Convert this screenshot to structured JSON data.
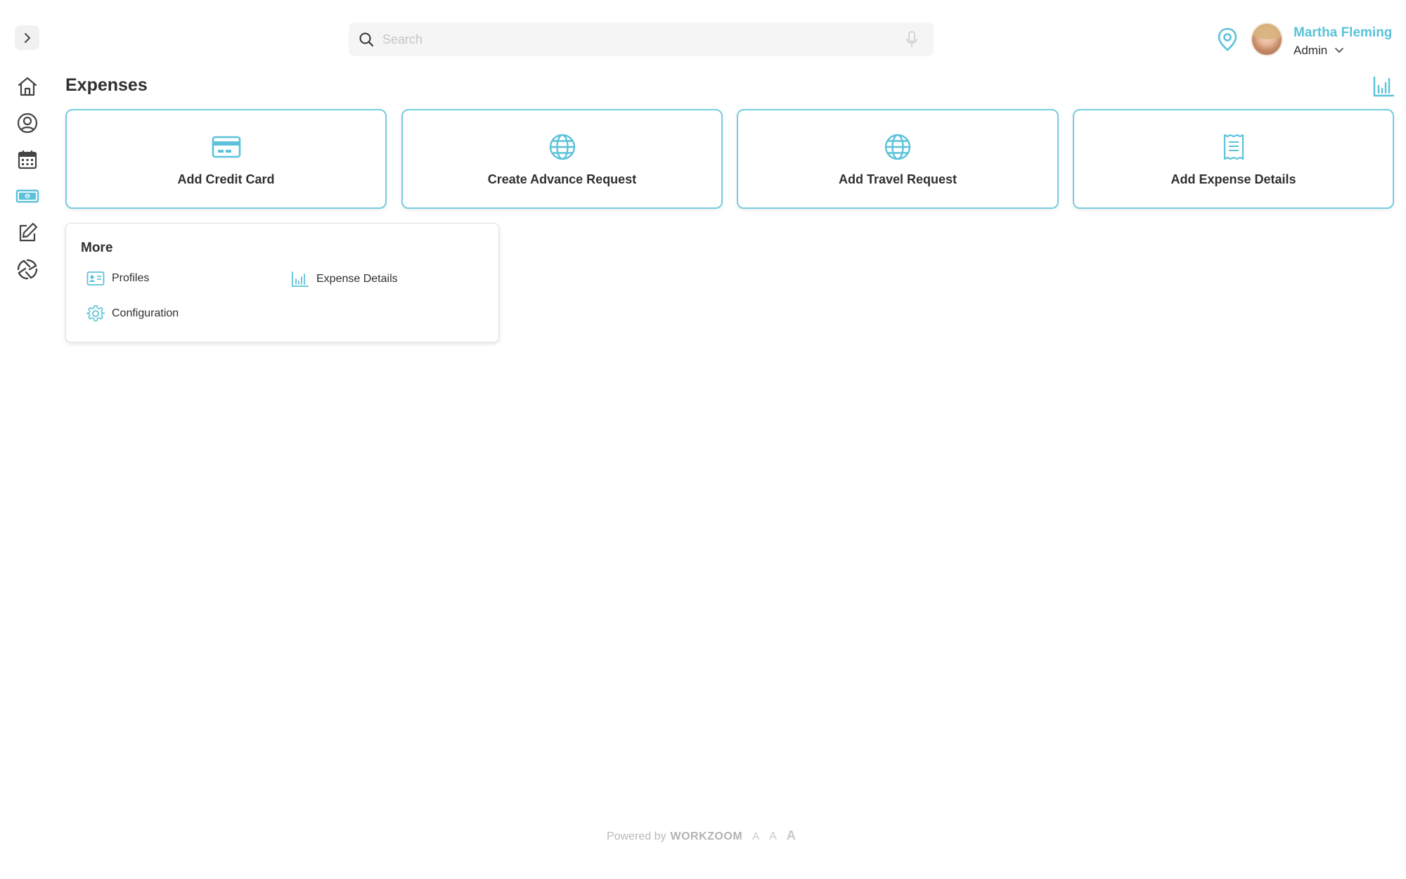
{
  "sidebar": {
    "toggle_icon": "chevron-right-icon",
    "items": [
      {
        "name": "home",
        "icon": "home-icon"
      },
      {
        "name": "profile",
        "icon": "user-circle-icon"
      },
      {
        "name": "calendar",
        "icon": "calendar-icon"
      },
      {
        "name": "expenses",
        "icon": "money-icon",
        "active": true
      },
      {
        "name": "edit",
        "icon": "edit-icon"
      },
      {
        "name": "sync",
        "icon": "aperture-icon"
      }
    ]
  },
  "search": {
    "placeholder": "Search"
  },
  "user": {
    "name": "Martha Fleming",
    "role": "Admin"
  },
  "page": {
    "title": "Expenses"
  },
  "cards": [
    {
      "label": "Add Credit Card",
      "icon": "credit-card-icon"
    },
    {
      "label": "Create Advance Request",
      "icon": "globe-icon"
    },
    {
      "label": "Add Travel Request",
      "icon": "globe-icon"
    },
    {
      "label": "Add Expense Details",
      "icon": "receipt-icon"
    }
  ],
  "more": {
    "title": "More",
    "items": [
      {
        "label": "Profiles",
        "icon": "id-card-icon"
      },
      {
        "label": "Expense Details",
        "icon": "bar-chart-icon"
      },
      {
        "label": "Configuration",
        "icon": "gear-icon"
      }
    ]
  },
  "footer": {
    "powered_by": "Powered by",
    "brand": "WORKZOOM",
    "font_sizes": [
      "A",
      "A",
      "A"
    ]
  },
  "colors": {
    "accent": "#5bc2d9",
    "text": "#2f2f2f"
  }
}
